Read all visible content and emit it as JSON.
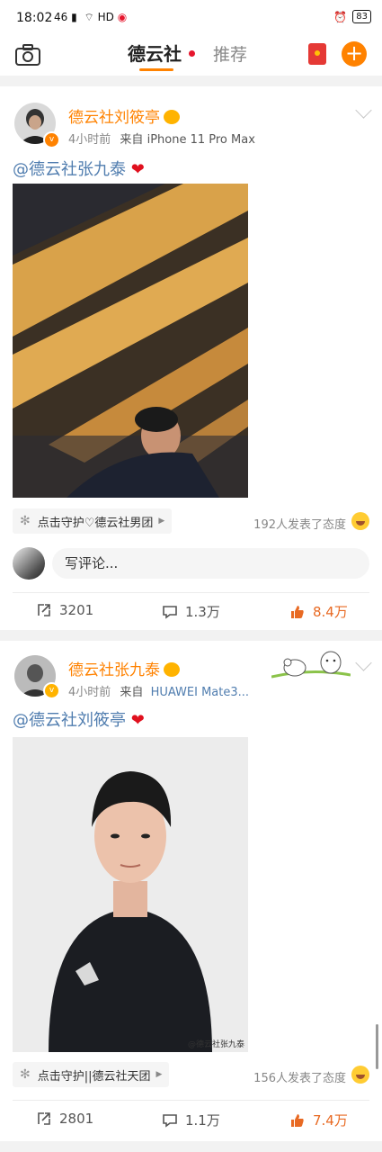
{
  "status_bar": {
    "time": "18:02",
    "signal": "46",
    "network": "HD",
    "battery": "83"
  },
  "nav": {
    "active_tab": "德云社",
    "inactive_tab": "推荐",
    "plus": "+"
  },
  "posts": [
    {
      "user": "德云社刘筱亭",
      "time": "4小时前",
      "source_prefix": "来自",
      "source": "iPhone 11 Pro Max",
      "text_mention": "@德云社张九泰",
      "heart": "❤",
      "topic": "点击守护♡德云社男团",
      "reactions": "192人发表了态度",
      "comment_placeholder": "写评论...",
      "reposts": "3201",
      "comments": "1.3万",
      "likes": "8.4万"
    },
    {
      "user": "德云社张九泰",
      "time": "4小时前",
      "source_prefix": "来自",
      "source": "HUAWEI Mate3...",
      "text_mention": "@德云社刘筱亭",
      "heart": "❤",
      "watermark": "@德云社张九泰",
      "topic": "点击守护||德云社天团",
      "reactions": "156人发表了态度",
      "reposts": "2801",
      "comments": "1.1万",
      "likes": "7.4万"
    }
  ],
  "colors": {
    "accent": "#ff8200",
    "link": "#507daf",
    "like": "#e86a23"
  }
}
